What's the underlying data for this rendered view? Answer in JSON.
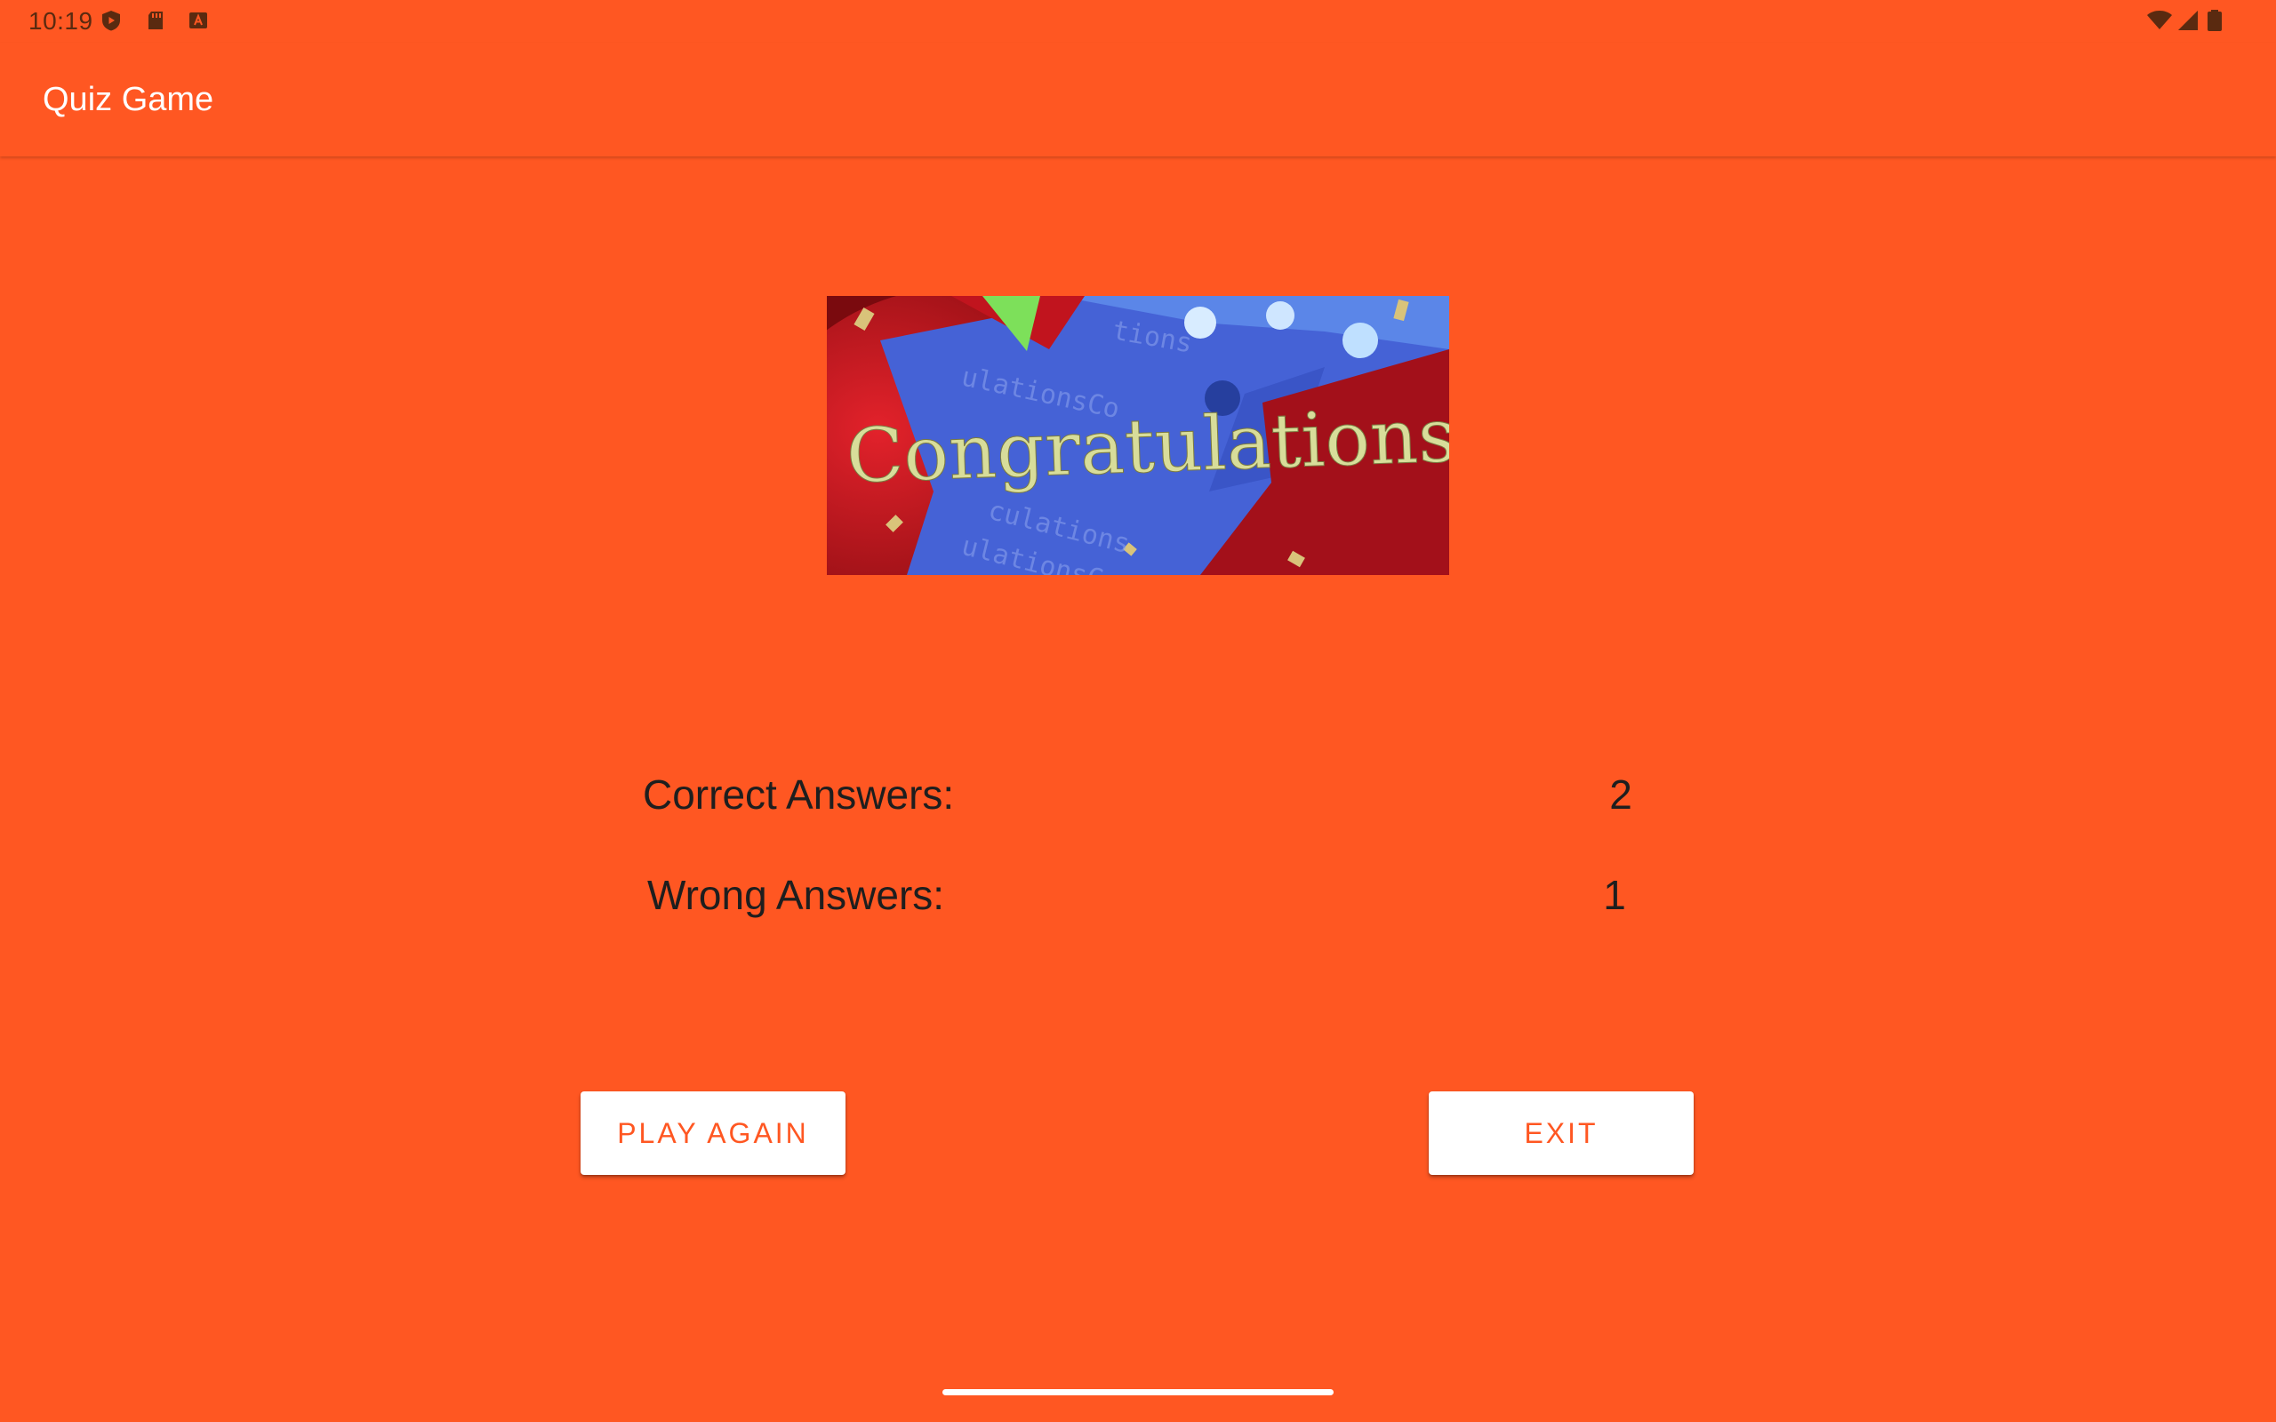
{
  "status_bar": {
    "time": "10:19",
    "left_icons": [
      "shield-play-icon",
      "sd-card-icon",
      "keyboard-a-icon"
    ],
    "right_icons": [
      "wifi-icon",
      "cell-signal-icon",
      "battery-icon"
    ]
  },
  "app_bar": {
    "title": "Quiz Game"
  },
  "banner": {
    "text": "Congratulations!",
    "description": "congratulations-balloon-image"
  },
  "results": {
    "correct_label": "Correct Answers:",
    "correct_value": "2",
    "wrong_label": "Wrong Answers:",
    "wrong_value": "1"
  },
  "buttons": {
    "play_again": "PLAY AGAIN",
    "exit": "EXIT"
  },
  "colors": {
    "primary": "#FF5722",
    "button_bg": "#FFFFFF",
    "text": "#1E1E1E"
  }
}
